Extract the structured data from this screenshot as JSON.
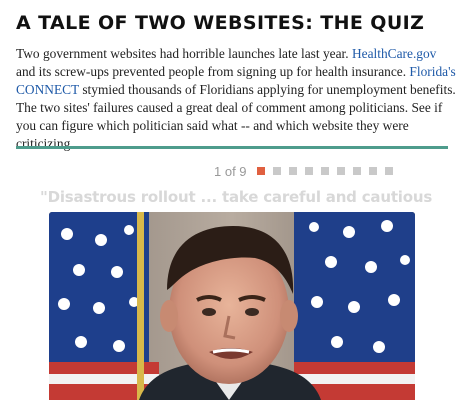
{
  "header": {
    "title": "A TALE OF TWO WEBSITES: THE QUIZ"
  },
  "intro": {
    "text_1": "Two government websites had horrible launches late last year. ",
    "link_healthcare": "HealthCare.gov",
    "text_2": " and its screw-ups prevented people from signing up for health insurance. ",
    "link_connect": "Florida's CONNECT",
    "text_3": " stymied thousands of Floridians applying for unemployment benefits. The two sites' failures caused a great deal of comment among politicians. See if you can figure which politician said what -- and which website they were criticizing."
  },
  "pager": {
    "current": "1",
    "separator": "of",
    "total": "9",
    "count_label": "1 of 9",
    "active_index": 0,
    "dot_count": 9
  },
  "slide": {
    "quote": "\"Disastrous rollout ... take careful and cautious",
    "photo_icon": "politician-photo"
  },
  "colors": {
    "accent_divider": "#4e9c8c",
    "active_dot": "#e06040",
    "inactive_dot": "#c9c9c9",
    "link": "#1f5aa8"
  }
}
